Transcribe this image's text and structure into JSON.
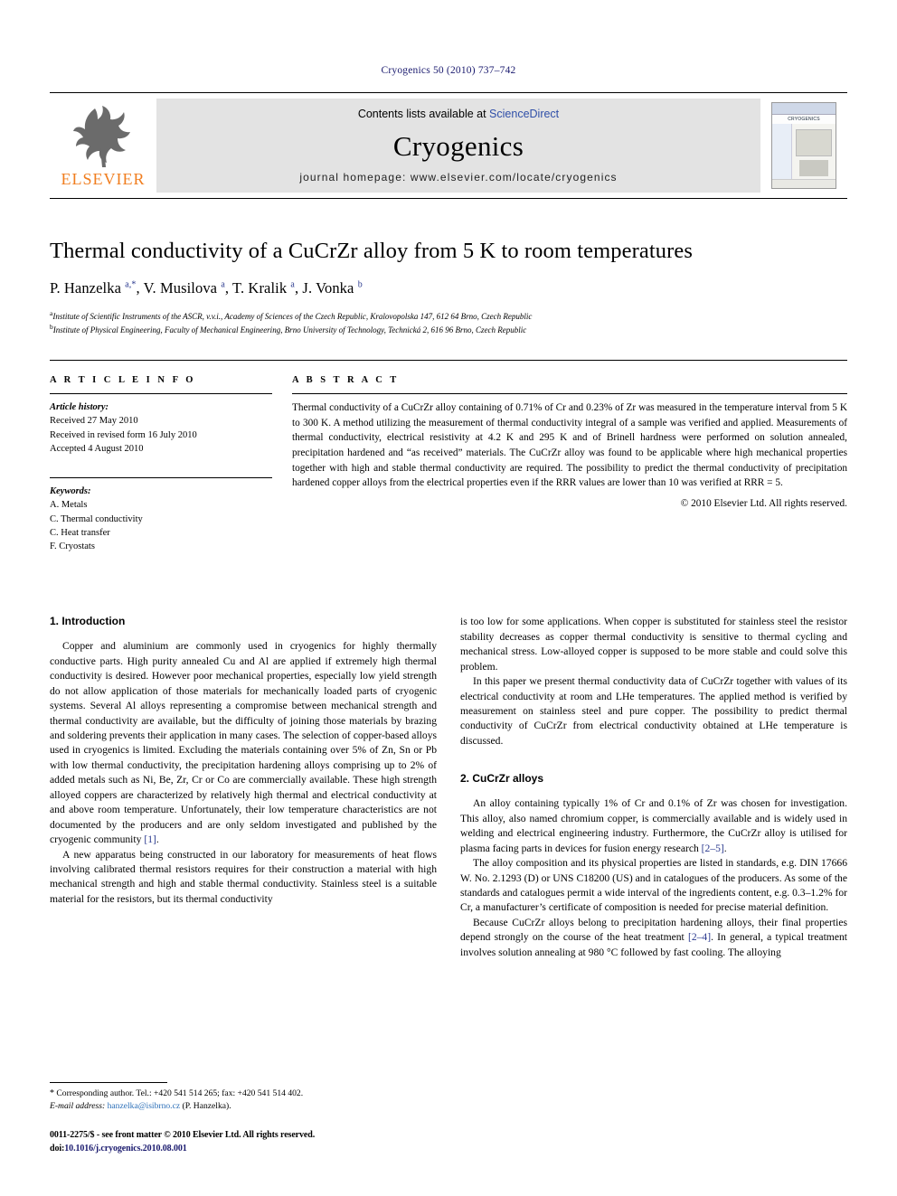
{
  "running_head": "Cryogenics 50 (2010) 737–742",
  "banner": {
    "publisher": "ELSEVIER",
    "contents_prefix": "Contents lists available at ",
    "contents_link": "ScienceDirect",
    "journal_name": "Cryogenics",
    "homepage": "journal homepage: www.elsevier.com/locate/cryogenics",
    "cover_label": "CRYOGENICS"
  },
  "title": "Thermal conductivity of a CuCrZr alloy from 5 K to room temperatures",
  "authors_html": "P. Hanzelka <sup>a,*</sup>, V. Musilova <sup>a</sup>, T. Kralik <sup>a</sup>, J. Vonka <sup>b</sup>",
  "affiliations": [
    "Institute of Scientific Instruments of the ASCR, v.v.i., Academy of Sciences of the Czech Republic, Kralovopolska 147, 612 64 Brno, Czech Republic",
    "Institute of Physical Engineering, Faculty of Mechanical Engineering, Brno University of Technology, Technická 2, 616 96 Brno, Czech Republic"
  ],
  "article_info": {
    "heading": "A R T I C L E    I N F O",
    "history_label": "Article history:",
    "history": [
      "Received 27 May 2010",
      "Received in revised form 16 July 2010",
      "Accepted 4 August 2010"
    ],
    "keywords_label": "Keywords:",
    "keywords": [
      "A. Metals",
      "C. Thermal conductivity",
      "C. Heat transfer",
      "F. Cryostats"
    ]
  },
  "abstract": {
    "heading": "A B S T R A C T",
    "text": "Thermal conductivity of a CuCrZr alloy containing of 0.71% of Cr and 0.23% of Zr was measured in the temperature interval from 5 K to 300 K. A method utilizing the measurement of thermal conductivity integral of a sample was verified and applied. Measurements of thermal conductivity, electrical resistivity at 4.2 K and 295 K and of Brinell hardness were performed on solution annealed, precipitation hardened and “as received” materials. The CuCrZr alloy was found to be applicable where high mechanical properties together with high and stable thermal conductivity are required. The possibility to predict the thermal conductivity of precipitation hardened copper alloys from the electrical properties even if the RRR values are lower than 10 was verified at RRR = 5.",
    "copyright": "© 2010 Elsevier Ltd. All rights reserved."
  },
  "sections": {
    "introduction_heading": "1. Introduction",
    "intro_p1": "Copper and aluminium are commonly used in cryogenics for highly thermally conductive parts. High purity annealed Cu and Al are applied if extremely high thermal conductivity is desired. However poor mechanical properties, especially low yield strength do not allow application of those materials for mechanically loaded parts of cryogenic systems. Several Al alloys representing a compromise between mechanical strength and thermal conductivity are available, but the difficulty of joining those materials by brazing and soldering prevents their application in many cases. The selection of copper-based alloys used in cryogenics is limited. Excluding the materials containing over 5% of Zn, Sn or Pb with low thermal conductivity, the precipitation hardening alloys comprising up to 2% of added metals such as Ni, Be, Zr, Cr or Co are commercially available. These high strength alloyed coppers are characterized by relatively high thermal and electrical conductivity at and above room temperature. Unfortunately, their low temperature characteristics are not documented by the producers and are only seldom investigated and published by the cryogenic community ",
    "intro_p1_ref": "[1]",
    "intro_p1_tail": ".",
    "intro_p2": "A new apparatus being constructed in our laboratory for measurements of heat flows involving calibrated thermal resistors requires for their construction a material with high mechanical strength and high and stable thermal conductivity. Stainless steel is a suitable material for the resistors, but its thermal conductivity",
    "intro_p2_cont": "is too low for some applications. When copper is substituted for stainless steel the resistor stability decreases as copper thermal conductivity is sensitive to thermal cycling and mechanical stress. Low-alloyed copper is supposed to be more stable and could solve this problem.",
    "intro_p3": "In this paper we present thermal conductivity data of CuCrZr together with values of its electrical conductivity at room and LHe temperatures. The applied method is verified by measurement on stainless steel and pure copper. The possibility to predict thermal conductivity of CuCrZr from electrical conductivity obtained at LHe temperature is discussed.",
    "alloys_heading": "2. CuCrZr alloys",
    "alloys_p1": "An alloy containing typically 1% of Cr and 0.1% of Zr was chosen for investigation. This alloy, also named chromium copper, is commercially available and is widely used in welding and electrical engineering industry. Furthermore, the CuCrZr alloy is utilised for plasma facing parts in devices for fusion energy research ",
    "alloys_p1_ref": "[2–5]",
    "alloys_p1_tail": ".",
    "alloys_p2": "The alloy composition and its physical properties are listed in standards, e.g. DIN 17666 W. No. 2.1293 (D) or UNS C18200 (US) and in catalogues of the producers. As some of the standards and catalogues permit a wide interval of the ingredients content, e.g. 0.3–1.2% for Cr, a manufacturer’s certificate of composition is needed for precise material definition.",
    "alloys_p3_head": "Because CuCrZr alloys belong to precipitation hardening alloys, their final properties depend strongly on the course of the heat treatment ",
    "alloys_p3_ref": "[2–4]",
    "alloys_p3_tail": ". In general, a typical treatment involves solution annealing at 980 °C followed by fast cooling. The alloying"
  },
  "footnote": {
    "star": "*",
    "corresponding": "Corresponding author. Tel.: +420 541 514 265; fax: +420 541 514 402.",
    "email_label": "E-mail address:",
    "email": "hanzelka@isibrno.cz",
    "email_owner": "(P. Hanzelka)."
  },
  "imprint": {
    "line1": "0011-2275/$ - see front matter © 2010 Elsevier Ltd. All rights reserved.",
    "doi_label": "doi:",
    "doi": "10.1016/j.cryogenics.2010.08.001"
  },
  "colors": {
    "link_blue": "#2b3a8f",
    "elsevier_orange": "#F07D1E",
    "banner_grey": "#e3e3e3"
  }
}
